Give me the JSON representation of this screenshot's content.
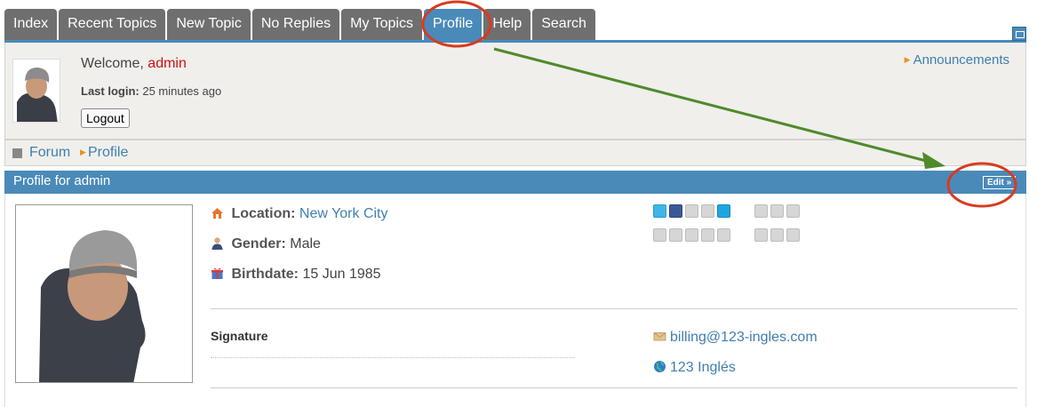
{
  "tabs": [
    "Index",
    "Recent Topics",
    "New Topic",
    "No Replies",
    "My Topics",
    "Profile",
    "Help",
    "Search"
  ],
  "active_tab": "Profile",
  "user_panel": {
    "welcome_prefix": "Welcome,",
    "username": "admin",
    "last_login_label": "Last login:",
    "last_login_value": "25 minutes ago",
    "logout_label": "Logout",
    "announcements_label": "Announcements"
  },
  "breadcrumb": {
    "forum": "Forum",
    "profile": "Profile"
  },
  "profile": {
    "title": "Profile for admin",
    "edit_label": "Edit »",
    "location_label": "Location:",
    "location_value": "New York City",
    "gender_label": "Gender:",
    "gender_value": "Male",
    "birthdate_label": "Birthdate:",
    "birthdate_value": "15 Jun 1985",
    "signature_label": "Signature",
    "email": "billing@123-ingles.com",
    "website": "123 Inglés"
  },
  "colors": {
    "tab_bg": "#6f6f6f",
    "tab_active": "#4a8ab9",
    "link": "#3f7fae",
    "username": "#cc1111",
    "annotation_red": "#d93a1e",
    "annotation_green": "#4f8a2b"
  }
}
